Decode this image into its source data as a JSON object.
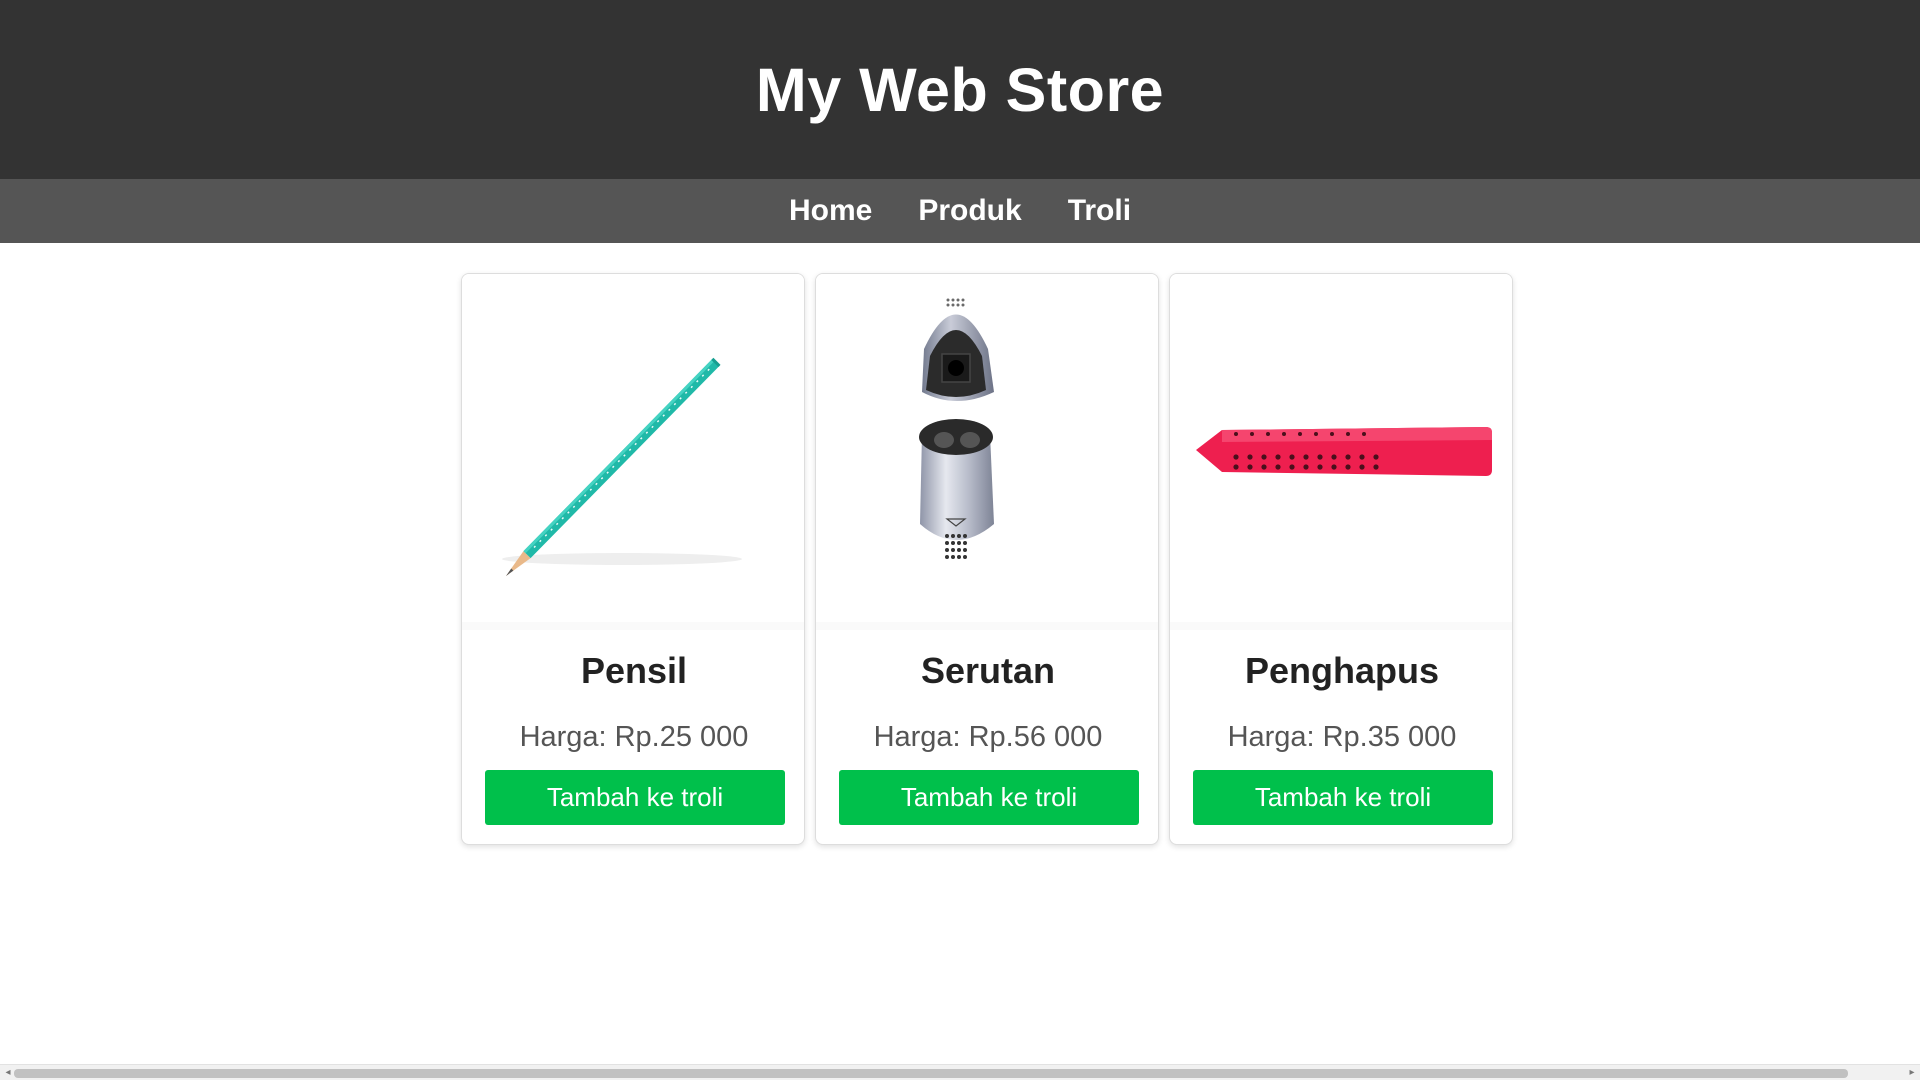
{
  "header": {
    "title": "My Web Store"
  },
  "nav": {
    "items": [
      {
        "label": "Home"
      },
      {
        "label": "Produk"
      },
      {
        "label": "Troli"
      }
    ]
  },
  "products": [
    {
      "name": "Pensil",
      "price_label": "Harga:",
      "price_value": "Rp.25 000",
      "button": "Tambah ke troli",
      "image_icon": "pencil-image"
    },
    {
      "name": "Serutan",
      "price_label": "Harga:",
      "price_value": "Rp.56 000",
      "button": "Tambah ke troli",
      "image_icon": "sharpener-image"
    },
    {
      "name": "Penghapus",
      "price_label": "Harga:",
      "price_value": "Rp.35 000",
      "button": "Tambah ke troli",
      "image_icon": "eraser-image"
    }
  ],
  "colors": {
    "header_bg": "#333333",
    "nav_bg": "#555555",
    "button_bg": "#00c04b",
    "pencil": "#20b9a8",
    "eraser": "#ee1f4f"
  }
}
